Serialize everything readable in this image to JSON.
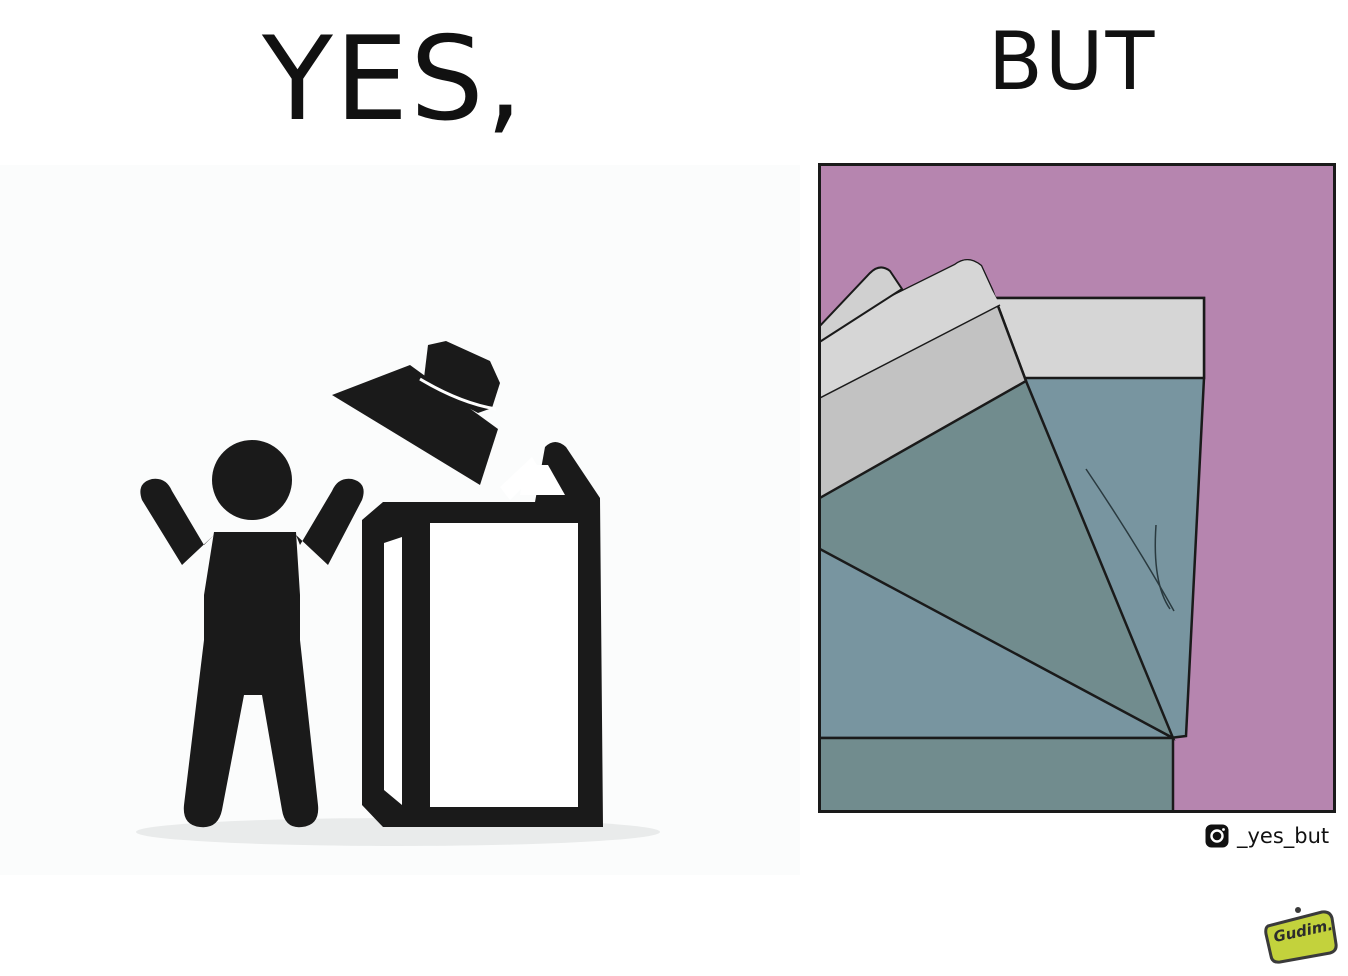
{
  "panels": {
    "left": {
      "heading": "YES,"
    },
    "right": {
      "heading": "BUT"
    }
  },
  "credit": {
    "icon": "instagram-icon",
    "handle": "_yes_but"
  },
  "signature": {
    "text": "Gudim."
  },
  "colors": {
    "background": "#ffffff",
    "icon_black": "#1a1a1a",
    "wall_purple": "#b685af",
    "carton_top_gray": "#d2d2d2",
    "carton_blue_gray": "#7895a0",
    "carton_dark_teal": "#718c8e",
    "signature_yellow": "#c3d23c"
  }
}
